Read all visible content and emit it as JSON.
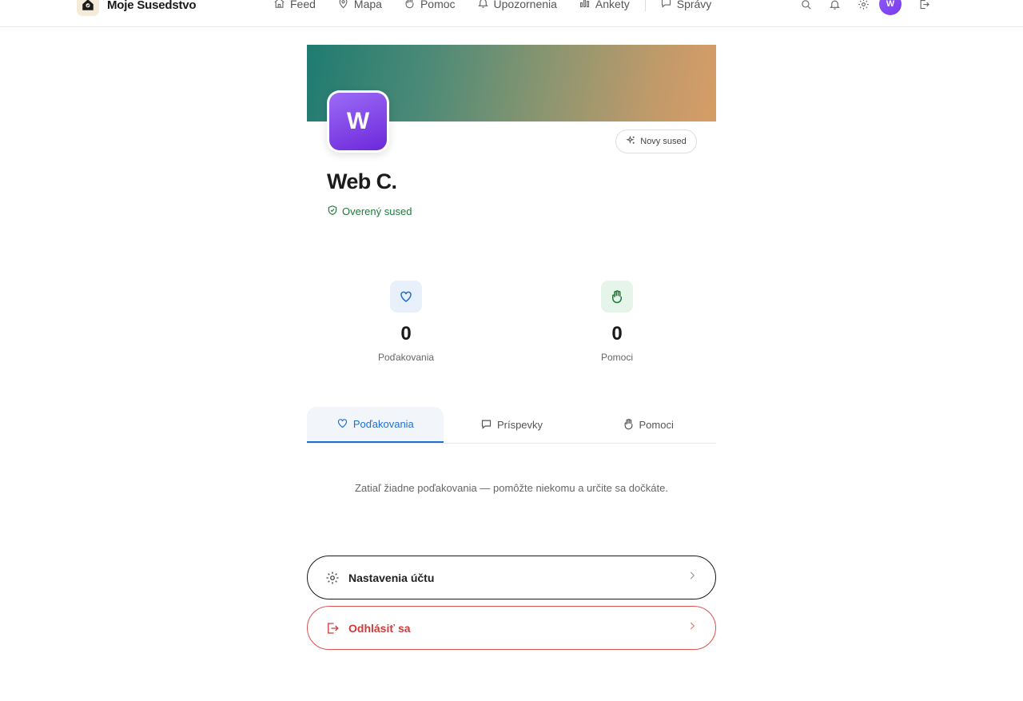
{
  "brand": {
    "name": "Moje Susedstvo"
  },
  "nav": {
    "items": [
      {
        "label": "Feed",
        "icon": "home-icon"
      },
      {
        "label": "Mapa",
        "icon": "map-pin-icon"
      },
      {
        "label": "Pomoc",
        "icon": "hand-icon"
      },
      {
        "label": "Upozornenia",
        "icon": "bell-icon"
      },
      {
        "label": "Ankety",
        "icon": "bar-chart-icon"
      },
      {
        "label": "Správy",
        "icon": "chat-icon"
      }
    ],
    "right_icons": [
      "search-icon",
      "bell-icon",
      "gear-icon",
      "avatar",
      "logout-icon"
    ],
    "avatar_initial": "W"
  },
  "profile": {
    "avatar_initial": "W",
    "name": "Web C.",
    "verified_label": "Overený sused",
    "new_badge": "Novy sused",
    "colors": {
      "avatar": "#7c3aed",
      "verified": "#1f7a3a",
      "accent": "#1f6fd1",
      "danger": "#d23a3a"
    }
  },
  "stats": [
    {
      "value": "0",
      "label": "Poďakovania",
      "icon": "heart-icon"
    },
    {
      "value": "0",
      "label": "Pomoci",
      "icon": "hand-icon"
    }
  ],
  "tabs": [
    {
      "label": "Poďakovania",
      "icon": "heart-icon",
      "active": true
    },
    {
      "label": "Príspevky",
      "icon": "chat-icon",
      "active": false
    },
    {
      "label": "Pomoci",
      "icon": "hand-icon",
      "active": false
    }
  ],
  "empty_message": "Zatiaľ žiadne poďakovania — pomôžte niekomu a určite sa dočkáte.",
  "actions": {
    "settings_label": "Nastavenia účtu",
    "logout_label": "Odhlásiť sa"
  }
}
